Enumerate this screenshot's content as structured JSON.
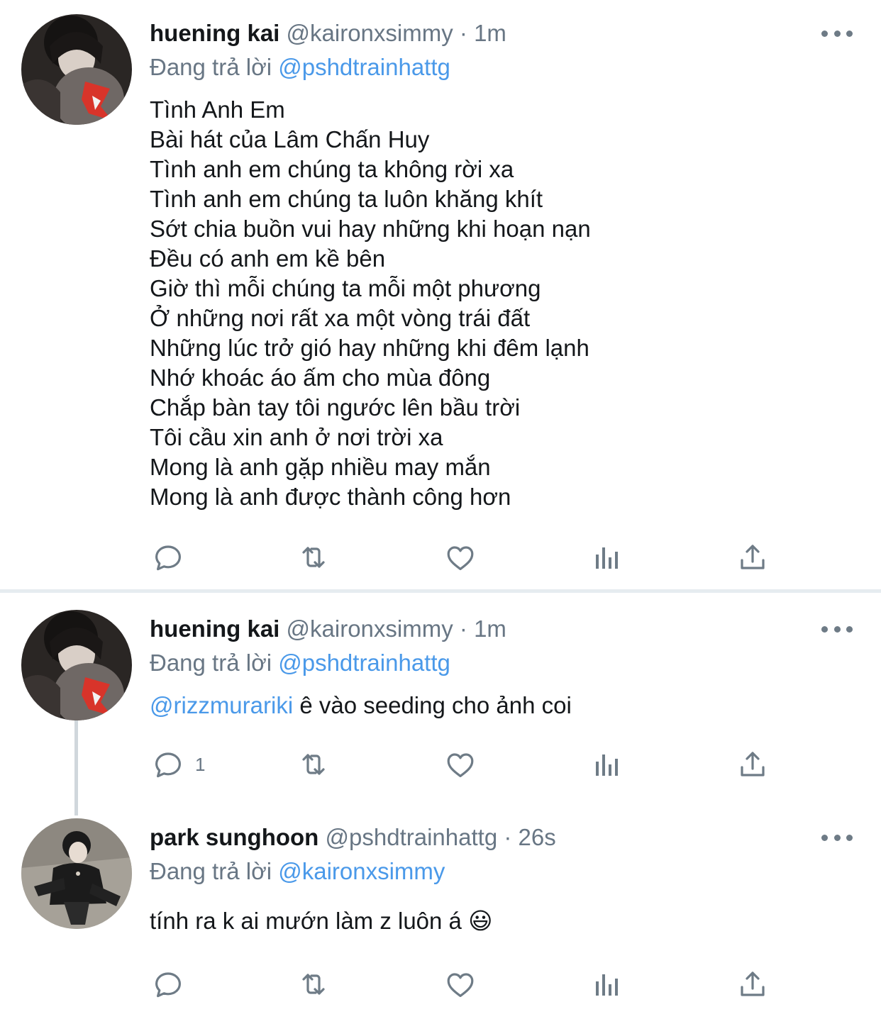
{
  "tweets": [
    {
      "name": "huening kai",
      "handle": "@kaironxsimmy",
      "dot": "·",
      "time": "1m",
      "replying_label": "Đang trả lời",
      "replying_to": "@pshdtrainhattg",
      "avatar_icon": "profile-photo",
      "lines": [
        "Tình Anh Em",
        "Bài hát của Lâm Chấn Huy",
        "Tình anh em chúng ta không rời xa",
        "Tình anh em chúng ta luôn khăng khít",
        "Sớt chia buồn vui hay những khi hoạn nạn",
        "Đều có anh em kề bên",
        "Giờ thì mỗi chúng ta mỗi một phương",
        "Ở những nơi rất xa một vòng trái đất",
        "Những lúc trở gió hay những khi đêm lạnh",
        "Nhớ khoác áo ấm cho mùa đông",
        "Chắp bàn tay tôi ngước lên bầu trời",
        "Tôi cầu xin anh ở nơi trời xa",
        "Mong là anh gặp nhiều may mắn",
        "Mong là anh được thành công hơn"
      ],
      "reply_count": ""
    },
    {
      "name": "huening kai",
      "handle": "@kaironxsimmy",
      "dot": "·",
      "time": "1m",
      "replying_label": "Đang trả lời",
      "replying_to": "@pshdtrainhattg",
      "avatar_icon": "profile-photo",
      "mention": "@rizzmurariki",
      "text": " ê vào seeding cho ảnh coi",
      "reply_count": "1"
    },
    {
      "name": "park sunghoon",
      "handle": "@pshdtrainhattg",
      "dot": "·",
      "time": "26s",
      "replying_label": "Đang trả lời",
      "replying_to": "@kaironxsimmy",
      "avatar_icon": "profile-photo",
      "text": "tính ra k ai mướn làm z luôn á ",
      "emoji": "😃",
      "reply_count": ""
    }
  ],
  "action_icons": [
    "reply-icon",
    "retweet-icon",
    "like-icon",
    "analytics-icon",
    "share-icon"
  ],
  "colors": {
    "link": "#4a99e9",
    "muted": "#687684",
    "text": "#14171a",
    "separator": "#e6ecf0"
  }
}
